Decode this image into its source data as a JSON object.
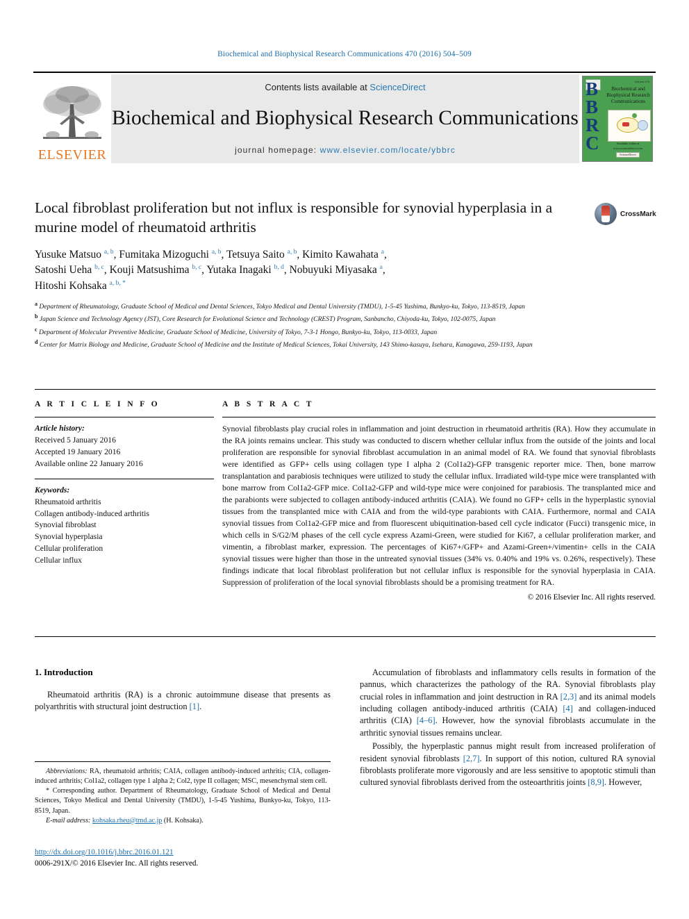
{
  "running_head": "Biochemical and Biophysical Research Communications 470 (2016) 504–509",
  "masthead": {
    "contents_prefix": "Contents lists available at ",
    "contents_link": "ScienceDirect",
    "journal_name": "Biochemical and Biophysical Research Communications",
    "homepage_label": "journal homepage: ",
    "homepage_link": "www.elsevier.com/locate/ybbrc",
    "publisher": "ELSEVIER",
    "cover": {
      "letters": "BBRC",
      "title": "Biochemical and Biophysical Research Communications",
      "top_right": "Volume 470",
      "bottom_text": "Available online at www.sciencedirect.com",
      "badge": "ScienceDirect"
    }
  },
  "article": {
    "title": "Local fibroblast proliferation but not influx is responsible for synovial hyperplasia in a murine model of rheumatoid arthritis",
    "crossmark_label": "CrossMark",
    "authors_line1": "Yusuke Matsuo a, b, Fumitaka Mizoguchi a, b, Tetsuya Saito a, b, Kimito Kawahata a,",
    "authors_line2": "Satoshi Ueha b, c, Kouji Matsushima b, c, Yutaka Inagaki b, d, Nobuyuki Miyasaka a,",
    "authors_line3": "Hitoshi Kohsaka a, b, *",
    "authors": [
      {
        "name": "Yusuke Matsuo",
        "sup": "a, b"
      },
      {
        "name": "Fumitaka Mizoguchi",
        "sup": "a, b"
      },
      {
        "name": "Tetsuya Saito",
        "sup": "a, b"
      },
      {
        "name": "Kimito Kawahata",
        "sup": "a"
      },
      {
        "name": "Satoshi Ueha",
        "sup": "b, c"
      },
      {
        "name": "Kouji Matsushima",
        "sup": "b, c"
      },
      {
        "name": "Yutaka Inagaki",
        "sup": "b, d"
      },
      {
        "name": "Nobuyuki Miyasaka",
        "sup": "a"
      },
      {
        "name": "Hitoshi Kohsaka",
        "sup": "a, b, *"
      }
    ],
    "affiliations": [
      {
        "label": "a",
        "text": "Department of Rheumatology, Graduate School of Medical and Dental Sciences, Tokyo Medical and Dental University (TMDU), 1-5-45 Yushima, Bunkyo-ku, Tokyo, 113-8519, Japan"
      },
      {
        "label": "b",
        "text": "Japan Science and Technology Agency (JST), Core Research for Evolutional Science and Technology (CREST) Program, Sanbancho, Chiyoda-ku, Tokyo, 102-0075, Japan"
      },
      {
        "label": "c",
        "text": "Department of Molecular Preventive Medicine, Graduate School of Medicine, University of Tokyo, 7-3-1 Hongo, Bunkyo-ku, Tokyo, 113-0033, Japan"
      },
      {
        "label": "d",
        "text": "Center for Matrix Biology and Medicine, Graduate School of Medicine and the Institute of Medical Sciences, Tokai University, 143 Shimo-kasuya, Isehara, Kanagawa, 259-1193, Japan"
      }
    ]
  },
  "article_info": {
    "heading": "A R T I C L E  I N F O",
    "history_label": "Article history:",
    "history": [
      "Received 5 January 2016",
      "Accepted 19 January 2016",
      "Available online 22 January 2016"
    ],
    "keywords_label": "Keywords:",
    "keywords": [
      "Rheumatoid arthritis",
      "Collagen antibody-induced arthritis",
      "Synovial fibroblast",
      "Synovial hyperplasia",
      "Cellular proliferation",
      "Cellular influx"
    ]
  },
  "abstract": {
    "heading": "A B S T R A C T",
    "body": "Synovial fibroblasts play crucial roles in inflammation and joint destruction in rheumatoid arthritis (RA). How they accumulate in the RA joints remains unclear. This study was conducted to discern whether cellular influx from the outside of the joints and local proliferation are responsible for synovial fibroblast accumulation in an animal model of RA. We found that synovial fibroblasts were identified as GFP+ cells using collagen type I alpha 2 (Col1a2)-GFP transgenic reporter mice. Then, bone marrow transplantation and parabiosis techniques were utilized to study the cellular influx. Irradiated wild-type mice were transplanted with bone marrow from Col1a2-GFP mice. Col1a2-GFP and wild-type mice were conjoined for parabiosis. The transplanted mice and the parabionts were subjected to collagen antibody-induced arthritis (CAIA). We found no GFP+ cells in the hyperplastic synovial tissues from the transplanted mice with CAIA and from the wild-type parabionts with CAIA. Furthermore, normal and CAIA synovial tissues from Col1a2-GFP mice and from fluorescent ubiquitination-based cell cycle indicator (Fucci) transgenic mice, in which cells in S/G2/M phases of the cell cycle express Azami-Green, were studied for Ki67, a cellular proliferation marker, and vimentin, a fibroblast marker, expression. The percentages of Ki67+/GFP+ and Azami-Green+/vimentin+ cells in the CAIA synovial tissues were higher than those in the untreated synovial tissues (34% vs. 0.40% and 19% vs. 0.26%, respectively). These findings indicate that local fibroblast proliferation but not cellular influx is responsible for the synovial hyperplasia in CAIA. Suppression of proliferation of the local synovial fibroblasts should be a promising treatment for RA.",
    "copyright": "© 2016 Elsevier Inc. All rights reserved."
  },
  "introduction": {
    "heading": "1.  Introduction",
    "left_para1_a": "Rheumatoid arthritis (RA) is a chronic autoimmune disease that presents as polyarthritis with structural joint destruction ",
    "left_para1_ref": "[1]",
    "left_para1_b": ".",
    "right_para1_a": "Accumulation of fibroblasts and inflammatory cells results in formation of the pannus, which characterizes the pathology of the RA. Synovial fibroblasts play crucial roles in inflammation and joint destruction in RA ",
    "right_para1_ref1": "[2,3]",
    "right_para1_b": " and its animal models including collagen antibody-induced arthritis (CAIA) ",
    "right_para1_ref2": "[4]",
    "right_para1_c": " and collagen-induced arthritis (CIA) ",
    "right_para1_ref3": "[4–6]",
    "right_para1_d": ". However, how the synovial fibroblasts accumulate in the arthritic synovial tissues remains unclear.",
    "right_para2_a": "Possibly, the hyperplastic pannus might result from increased proliferation of resident synovial fibroblasts ",
    "right_para2_ref1": "[2,7]",
    "right_para2_b": ". In support of this notion, cultured RA synovial fibroblasts proliferate more vigorously and are less sensitive to apoptotic stimuli than cultured synovial fibroblasts derived from the osteoarthritis joints ",
    "right_para2_ref2": "[8,9]",
    "right_para2_c": ". However,"
  },
  "footnotes": {
    "abbreviations_label": "Abbreviations:",
    "abbreviations_text": " RA, rheumatoid arthritis; CAIA, collagen antibody-induced arthritis; CIA, collagen-induced arthritis; Col1a2, collagen type 1 alpha 2; Col2, type II collagen; MSC, mesenchymal stem cell.",
    "corresponding_marker": "*",
    "corresponding_text": " Corresponding author. Department of Rheumatology, Graduate School of Medical and Dental Sciences, Tokyo Medical and Dental University (TMDU), 1-5-45 Yushima, Bunkyo-ku, Tokyo, 113-8519, Japan.",
    "email_label": "E-mail address:",
    "email_link": "kohsaka.rheu@tmd.ac.jp",
    "email_suffix": " (H. Kohsaka)."
  },
  "doi": {
    "url": "http://dx.doi.org/10.1016/j.bbrc.2016.01.121",
    "issn_line": "0006-291X/© 2016 Elsevier Inc. All rights reserved."
  },
  "colors": {
    "link": "#1b6ca8",
    "science_direct": "#2a7ab0",
    "elsevier_orange": "#E87722",
    "cover_green": "#4aa050",
    "masthead_bg": "#e9e9e9"
  }
}
